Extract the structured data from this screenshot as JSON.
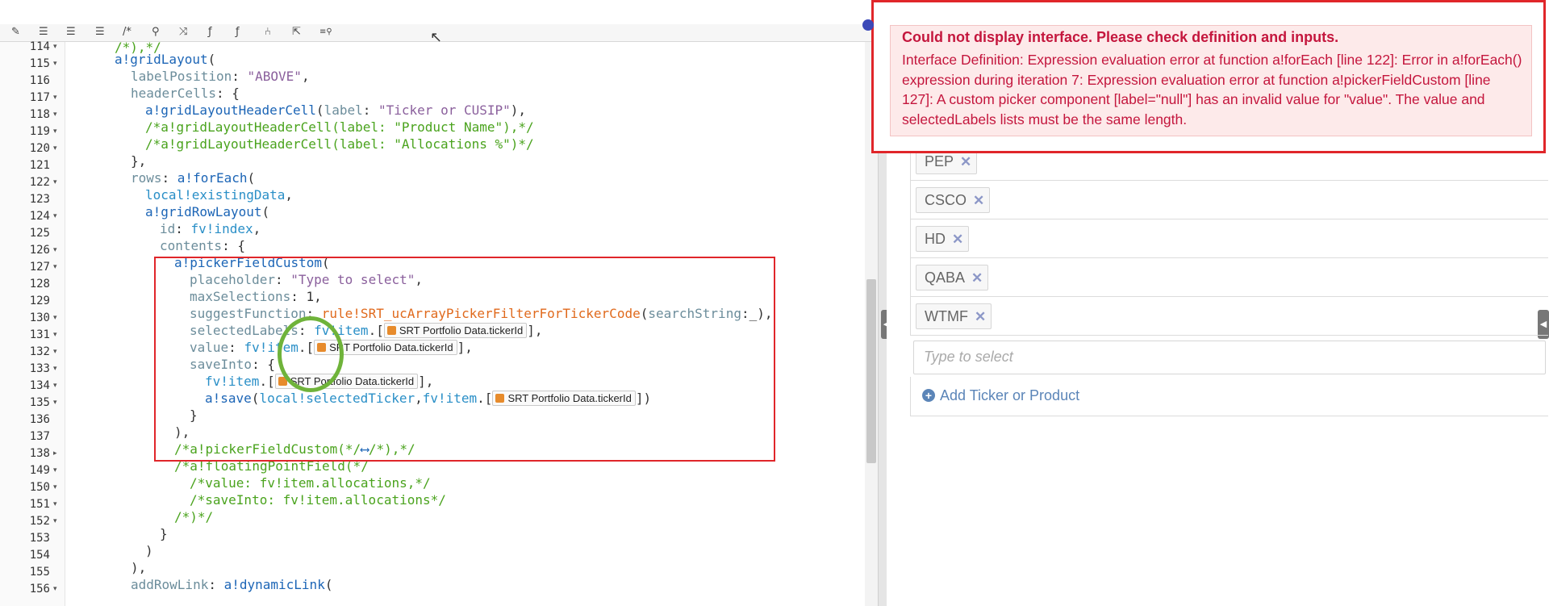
{
  "toolbar": {
    "icons": [
      "wrench-icon",
      "outdent-icon",
      "indent-icon",
      "list-icon",
      "comment-icon",
      "search-icon",
      "shuffle-icon",
      "function-x-icon",
      "function-alt-icon",
      "tree-icon",
      "export-icon",
      "zoom-text-icon"
    ]
  },
  "editor": {
    "line_numbers": [
      "114",
      "115",
      "116",
      "117",
      "118",
      "119",
      "120",
      "121",
      "122",
      "123",
      "124",
      "125",
      "126",
      "127",
      "128",
      "129",
      "130",
      "131",
      "132",
      "133",
      "134",
      "135",
      "136",
      "137",
      "138",
      "149",
      "150",
      "151",
      "152",
      "153",
      "154",
      "155",
      "156"
    ],
    "chip_label": "SRT Portfolio Data.tickerId",
    "lines": {
      "l114": "/*),*/",
      "l115a": "a!gridLayout",
      "l115b": "(",
      "l116a": "labelPosition",
      "l116b": ": ",
      "l116c": "\"ABOVE\"",
      "l116d": ",",
      "l117a": "headerCells",
      "l117b": ": {",
      "l118a": "a!gridLayoutHeaderCell",
      "l118b": "(",
      "l118c": "label",
      "l118d": ": ",
      "l118e": "\"Ticker or CUSIP\"",
      "l118f": "),",
      "l119": "/*a!gridLayoutHeaderCell(label: \"Product Name\"),*/",
      "l120": "/*a!gridLayoutHeaderCell(label: \"Allocations %\")*/",
      "l121": "},",
      "l122a": "rows",
      "l122b": ": ",
      "l122c": "a!forEach",
      "l122d": "(",
      "l123a": "local!existingData",
      "l123b": ",",
      "l124a": "a!gridRowLayout",
      "l124b": "(",
      "l125a": "id",
      "l125b": ": ",
      "l125c": "fv!index",
      "l125d": ",",
      "l126a": "contents",
      "l126b": ": {",
      "l127a": "a!pickerFieldCustom",
      "l127b": "(",
      "l128a": "placeholder",
      "l128b": ": ",
      "l128c": "\"Type to select\"",
      "l128d": ",",
      "l129a": "maxSelections",
      "l129b": ": 1,",
      "l130a": "suggestFunction",
      "l130b": ": ",
      "l130c": "rule!SRT_ucArrayPickerFilterForTickerCode",
      "l130d": "(",
      "l130e": "searchString",
      "l130f": ":_),",
      "l131a": "selectedLabels",
      "l131b": ": ",
      "l131c": "fv!item",
      "l131d": ".[",
      "l131e": "],",
      "l132a": "value",
      "l132b": ": ",
      "l132c": "fv!item",
      "l132d": ".[",
      "l132e": "],",
      "l133a": "saveInto",
      "l133b": ": {",
      "l134a": "fv!item",
      "l134b": ".[",
      "l134c": "],",
      "l135a": "a!save",
      "l135b": "(",
      "l135c": "local!selectedTicker",
      "l135d": ",",
      "l135e": "fv!item",
      "l135f": ".[",
      "l135g": "])",
      "l136": "}",
      "l137": "),",
      "l138a": "/*a!pickerFieldCustom(*/",
      "l138b": "⟷",
      "l138c": "/*),*/",
      "l149": "/*a!floatingPointField(*/",
      "l150": "/*value: fv!item.allocations,*/",
      "l151": "/*saveInto: fv!item.allocations*/",
      "l152": "/*)*/",
      "l153": "}",
      "l154": ")",
      "l155": "),",
      "l156a": "addRowLink",
      "l156b": ": ",
      "l156c": "a!dynamicLink",
      "l156d": "("
    }
  },
  "preview": {
    "tickers": [
      "PEP",
      "CSCO",
      "HD",
      "QABA",
      "WTMF"
    ],
    "remove_symbol": "✕",
    "input_placeholder": "Type to select",
    "add_link": "Add Ticker or Product",
    "add_symbol": "+",
    "collapse_symbol": "◀"
  },
  "error": {
    "title": "Could not display interface. Please check definition and inputs.",
    "body": "Interface Definition: Expression evaluation error at function a!forEach [line 122]: Error in a!forEach() expression during iteration 7: Expression evaluation error at function a!pickerFieldCustom [line 127]: A custom picker component [label=\"null\"] has an invalid value for \"value\". The value and selectedLabels lists must be the same length."
  },
  "colors": {
    "error_red": "#c4163d",
    "highlight_box": "#e0262a",
    "annotation_green": "#6fb33a",
    "link_blue": "#5b85b8"
  }
}
